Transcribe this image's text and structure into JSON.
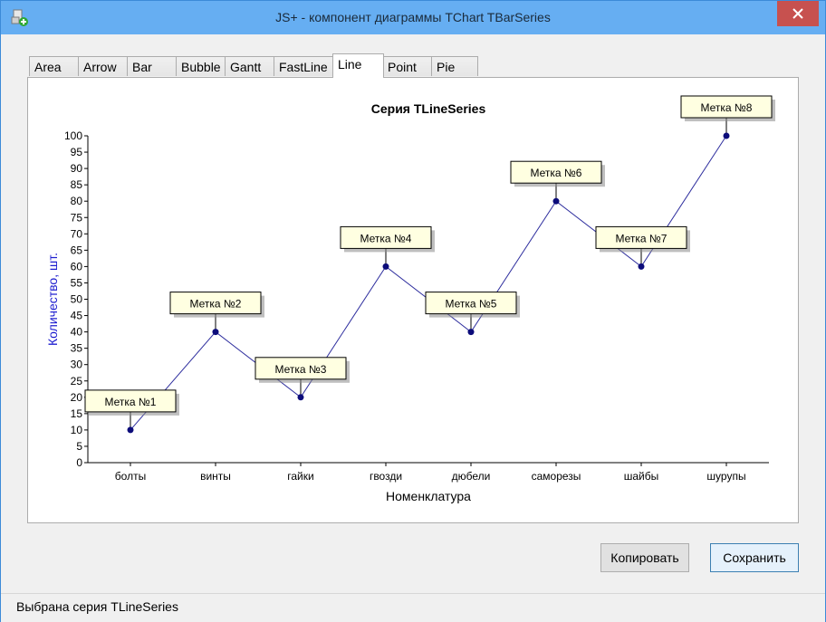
{
  "window": {
    "title": "JS+ - компонент диаграммы TChart TBarSeries"
  },
  "tabs": [
    {
      "label": "Area",
      "active": false
    },
    {
      "label": "Arrow",
      "active": false
    },
    {
      "label": "Bar",
      "active": false
    },
    {
      "label": "Bubble",
      "active": false
    },
    {
      "label": "Gantt",
      "active": false
    },
    {
      "label": "FastLine",
      "active": false
    },
    {
      "label": "Line",
      "active": true
    },
    {
      "label": "Point",
      "active": false
    },
    {
      "label": "Pie",
      "active": false
    }
  ],
  "buttons": {
    "copy_label": "Копировать",
    "save_label": "Сохранить"
  },
  "status": {
    "text": "Выбрана серия TLineSeries"
  },
  "colors": {
    "line": "#2e2e9e",
    "marker": "#0c0c7a",
    "label_bg": "#ffffe1",
    "ylabel": "#1d1dcf",
    "titlebar": "#66aef2",
    "close": "#c7514f"
  },
  "chart_data": {
    "type": "line",
    "title": "Серия TLineSeries",
    "xlabel": "Номенклатура",
    "ylabel": "Количество, шт.",
    "ylim": [
      0,
      100
    ],
    "yticks": [
      0,
      5,
      10,
      15,
      20,
      25,
      30,
      35,
      40,
      45,
      50,
      55,
      60,
      65,
      70,
      75,
      80,
      85,
      90,
      95,
      100
    ],
    "categories": [
      "болты",
      "винты",
      "гайки",
      "гвозди",
      "дюбели",
      "саморезы",
      "шайбы",
      "шурупы"
    ],
    "values": [
      10,
      40,
      20,
      60,
      40,
      80,
      60,
      100
    ],
    "point_labels": [
      "Метка №1",
      "Метка №2",
      "Метка №3",
      "Метка №4",
      "Метка №5",
      "Метка №6",
      "Метка №7",
      "Метка №8"
    ],
    "grid": false,
    "legend": "none"
  }
}
